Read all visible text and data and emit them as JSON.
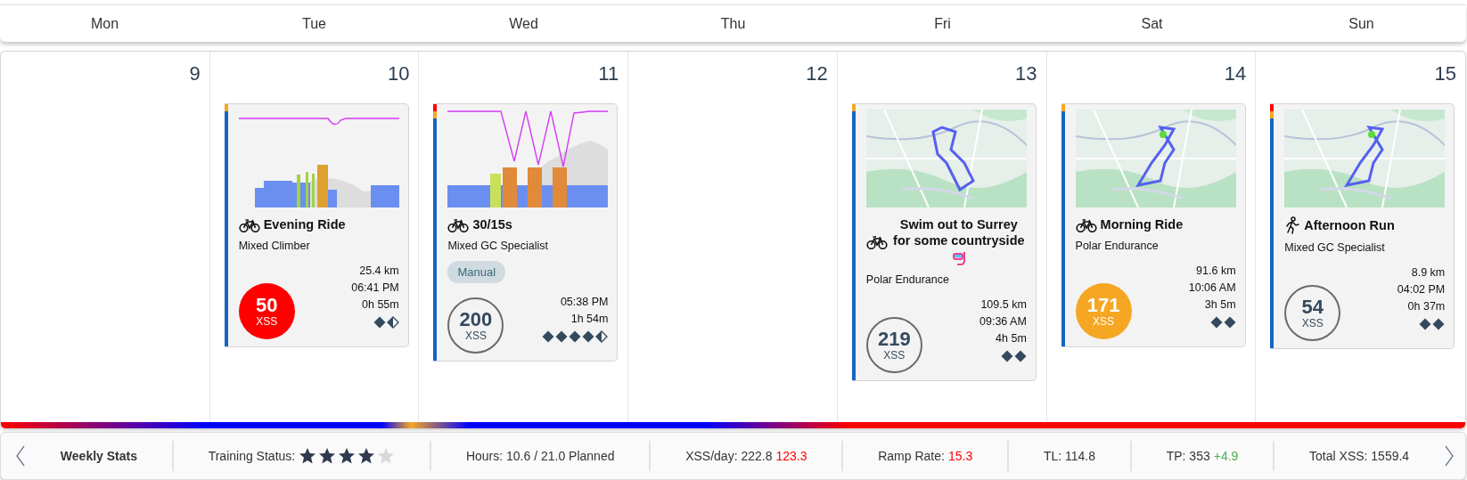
{
  "days": [
    {
      "label": "Mon"
    },
    {
      "label": "Tue"
    },
    {
      "label": "Wed"
    },
    {
      "label": "Thu"
    },
    {
      "label": "Fri"
    },
    {
      "label": "Sat"
    },
    {
      "label": "Sun"
    }
  ],
  "dates": [
    {
      "number": "9"
    },
    {
      "number": "10",
      "activities": [
        {
          "kind": "bike",
          "preview": {
            "kind": "chart"
          },
          "title": "Evening Ride",
          "profile": "Mixed Climber",
          "zones": [
            {
              "color": "#f5a623"
            },
            {
              "color": "#1565c0"
            }
          ],
          "xss": "50",
          "xss_label": "XSS",
          "color": "#ff0000",
          "stats": [
            "25.4 km",
            "06:41 PM",
            "0h 55m"
          ],
          "intensity": [
            {
              "kind": "full"
            },
            {
              "kind": "half"
            }
          ]
        }
      ]
    },
    {
      "number": "11",
      "activities": [
        {
          "kind": "bike",
          "preview": {
            "kind": "chart"
          },
          "title": "30/15s",
          "profile": "Mixed GC Specialist",
          "tag": "Manual",
          "zones": [
            {
              "color": "#ff0000"
            },
            {
              "color": "#f5a623"
            },
            {
              "color": "#1565c0"
            }
          ],
          "xss": "200",
          "xss_label": "XSS",
          "stats": [
            "05:38 PM",
            "1h 54m"
          ],
          "intensity": [
            {
              "kind": "full"
            },
            {
              "kind": "full"
            },
            {
              "kind": "full"
            },
            {
              "kind": "full"
            },
            {
              "kind": "half"
            }
          ]
        }
      ]
    },
    {
      "number": "12"
    },
    {
      "number": "13",
      "activities": [
        {
          "kind": "bike",
          "preview": {
            "kind": "picture"
          },
          "title": "Swim out to Surrey for some countryside",
          "extra_icon": {
            "kind": "snorkel"
          },
          "profile": "Polar Endurance",
          "zones": [
            {
              "color": "#f5a623"
            },
            {
              "color": "#1565c0"
            }
          ],
          "xss": "219",
          "xss_label": "XSS",
          "stats": [
            "109.5 km",
            "09:36 AM",
            "4h 5m"
          ],
          "intensity": [
            {
              "kind": "full"
            },
            {
              "kind": "full"
            }
          ]
        }
      ]
    },
    {
      "number": "14",
      "activities": [
        {
          "kind": "bike",
          "preview": {
            "kind": "picture"
          },
          "title": "Morning Ride",
          "profile": "Polar Endurance",
          "zones": [
            {
              "color": "#f5a623"
            },
            {
              "color": "#1565c0"
            }
          ],
          "xss": "171",
          "xss_label": "XSS",
          "color": "#f5a623",
          "stats": [
            "91.6 km",
            "10:06 AM",
            "3h 5m"
          ],
          "intensity": [
            {
              "kind": "full"
            },
            {
              "kind": "full"
            }
          ]
        }
      ]
    },
    {
      "number": "15",
      "activities": [
        {
          "kind": "run",
          "preview": {
            "kind": "picture"
          },
          "title": "Afternoon Run",
          "profile": "Mixed GC Specialist",
          "zones": [
            {
              "color": "#ff0000"
            },
            {
              "color": "#f5a623"
            },
            {
              "color": "#1565c0"
            }
          ],
          "xss": "54",
          "xss_label": "XSS",
          "stats": [
            "8.9 km",
            "04:02 PM",
            "0h 37m"
          ],
          "intensity": [
            {
              "kind": "full"
            },
            {
              "kind": "full"
            }
          ]
        }
      ]
    }
  ],
  "weekly_stats": {
    "title": "Weekly Stats",
    "training_status": {
      "label": "Training Status:",
      "stars": 4
    },
    "items": [
      {
        "text": "Hours: 10.6 / 21.0 Planned"
      },
      {
        "text": "XSS/day: 222.8",
        "value": "123.3",
        "color": "#ff0000"
      },
      {
        "text": "Ramp Rate:",
        "value": "15.3",
        "color": "#ff0000"
      },
      {
        "text": "TL: 114.8"
      },
      {
        "text": "TP: 353",
        "value": "+4.9",
        "color": "#4caf50"
      },
      {
        "text": "Total XSS: 1559.4"
      }
    ]
  }
}
